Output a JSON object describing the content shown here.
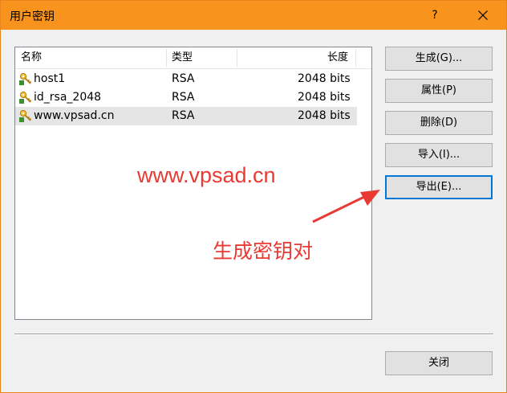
{
  "window": {
    "title": "用户密钥",
    "help_label": "?"
  },
  "list": {
    "columns": [
      "名称",
      "类型",
      "长度"
    ],
    "rows": [
      {
        "name": "host1",
        "type": "RSA",
        "length": "2048 bits"
      },
      {
        "name": "id_rsa_2048",
        "type": "RSA",
        "length": "2048 bits"
      },
      {
        "name": "www.vpsad.cn",
        "type": "RSA",
        "length": "2048 bits"
      }
    ]
  },
  "buttons": {
    "generate": "生成(G)...",
    "properties": "属性(P)",
    "delete": "删除(D)",
    "import": "导入(I)...",
    "export": "导出(E)...",
    "close": "关闭"
  },
  "overlay": {
    "watermark": "www.vpsad.cn",
    "annotation": "生成密钥对"
  },
  "colors": {
    "titlebar": "#f8941d",
    "annotation": "#e83a33",
    "focus": "#0078d7"
  },
  "icons": [
    "key-icon",
    "close-icon"
  ]
}
